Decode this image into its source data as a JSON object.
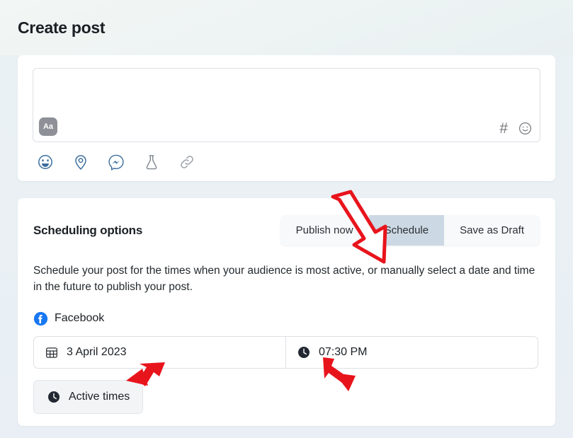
{
  "header": {
    "title": "Create post"
  },
  "composer": {
    "text_value": "",
    "format_button_label": "Aa",
    "format_button_icon": "text-format-icon",
    "right_icons": [
      {
        "name": "hashtag-icon",
        "glyph": "#"
      },
      {
        "name": "emoji-smile-icon",
        "glyph": "smile-outline"
      }
    ],
    "toolbar_icons": [
      {
        "name": "emoji-icon",
        "label": "Emoji"
      },
      {
        "name": "location-pin-icon",
        "label": "Location"
      },
      {
        "name": "messenger-icon",
        "label": "Messenger"
      },
      {
        "name": "flask-icon",
        "label": "Experiment"
      },
      {
        "name": "link-icon",
        "label": "Link"
      }
    ]
  },
  "scheduling": {
    "title": "Scheduling options",
    "tabs": [
      {
        "label": "Publish now",
        "selected": false
      },
      {
        "label": "Schedule",
        "selected": true
      },
      {
        "label": "Save as Draft",
        "selected": false
      }
    ],
    "description": "Schedule your post for the times when your audience is most active, or manually select a date and time in the future to publish your post.",
    "network": {
      "name": "Facebook",
      "icon": "facebook-logo-icon",
      "brand_color": "#1877F2"
    },
    "date_field": {
      "icon": "calendar-icon",
      "value": "3 April 2023"
    },
    "time_field": {
      "icon": "clock-icon",
      "value": "07:30 PM"
    },
    "active_times_button": {
      "icon": "clock-icon",
      "label": "Active times"
    }
  },
  "annotations": {
    "arrow_color": "#e8141c",
    "arrows": [
      {
        "name": "arrow-pointing-to-schedule-tab",
        "style": "outline",
        "direction": "down-right"
      },
      {
        "name": "arrow-pointing-to-date-field",
        "style": "solid",
        "direction": "down-left"
      },
      {
        "name": "arrow-pointing-to-time-field",
        "style": "solid",
        "direction": "down-right"
      }
    ]
  },
  "theme": {
    "page_background": "#eaf1f4",
    "card_background": "#ffffff",
    "selected_tab_background": "#ccd8e4",
    "icon_blue": "#2b6cb0"
  }
}
